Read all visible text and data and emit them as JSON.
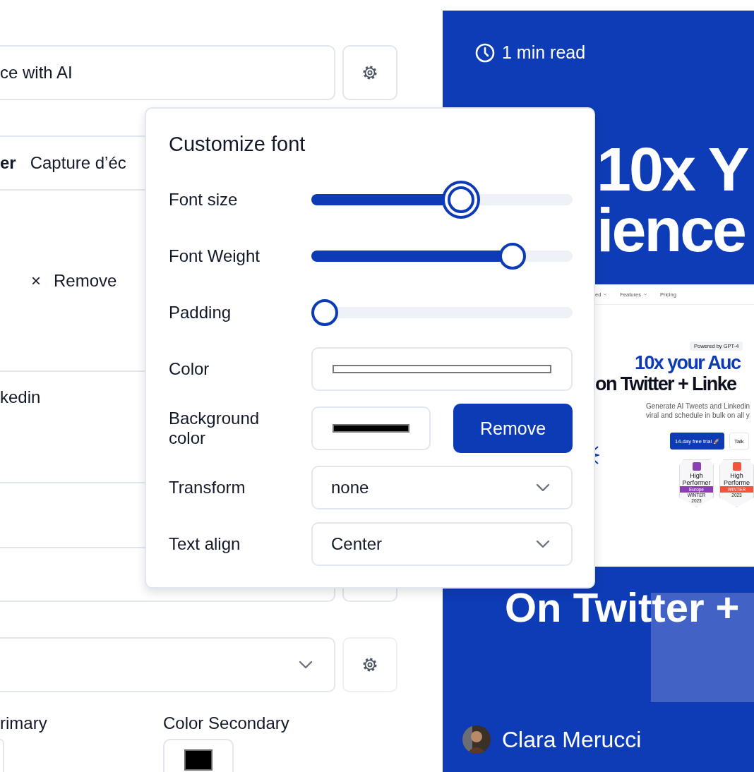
{
  "editor": {
    "title_field": {
      "value": "ce with AI"
    },
    "row": {
      "column_1": "er",
      "column_2": "Capture d’éc"
    },
    "remove_action": {
      "icon": "×",
      "label": "Remove"
    },
    "platform_field": {
      "value": "kedin"
    },
    "color_primary_label": "rimary",
    "color_secondary": {
      "label": "Color Secondary",
      "color": "#000000"
    }
  },
  "font_popover": {
    "title": "Customize font",
    "sliders": [
      {
        "label": "Font size",
        "level": 0.58,
        "focused": true
      },
      {
        "label": "Font Weight",
        "level": 0.8,
        "focused": false
      },
      {
        "label": "Padding",
        "level": 0,
        "focused": false
      }
    ],
    "color": {
      "label": "Color",
      "color": "#ffffff"
    },
    "background_color": {
      "label": "Background color",
      "color": "#000000",
      "button": "Remove"
    },
    "transform": {
      "label": "Transform",
      "value": "none"
    },
    "text_align": {
      "label": "Text align",
      "value": "Center"
    }
  },
  "preview": {
    "read_time": "1 min read",
    "heading_lines": [
      "10x Y",
      "ience"
    ],
    "screenshot": {
      "nav": [
        {
          "label": "ed",
          "expandable": true
        },
        {
          "label": "Features",
          "expandable": true
        },
        {
          "label": "Pricing",
          "expandable": false
        }
      ],
      "badge": "Powered by GPT-4",
      "headline": [
        "10x your Auc",
        "on Twitter + Linke"
      ],
      "subtitle": [
        "Generate AI Tweets and Linkedin",
        "viral and schedule in bulk on all y"
      ],
      "buttons": [
        {
          "label": "14-day free trial 🚀",
          "kind": "primary"
        },
        {
          "label": "Talk",
          "kind": "secondary"
        }
      ],
      "awards": [
        {
          "lines": [
            "High",
            "Performer"
          ],
          "ribbon": "Europe",
          "season": "WINTER",
          "year": "2023",
          "color": "#8b3fb5"
        },
        {
          "lines": [
            "High",
            "Performe"
          ],
          "ribbon": "WINTER",
          "year": "2023",
          "color": "#f2553c"
        }
      ]
    },
    "subheading": "On Twitter +",
    "author": "Clara Merucci"
  }
}
